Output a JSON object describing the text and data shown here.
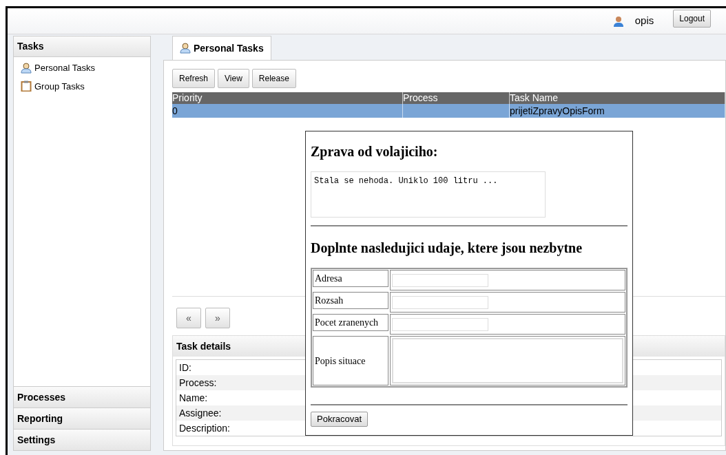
{
  "header": {
    "user": "opis",
    "logout": "Logout"
  },
  "sidebar": {
    "title": "Tasks",
    "items": [
      {
        "label": "Personal Tasks",
        "kind": "person"
      },
      {
        "label": "Group Tasks",
        "kind": "clipboard"
      }
    ],
    "sections": [
      "Processes",
      "Reporting",
      "Settings"
    ]
  },
  "tabs": [
    {
      "label": "Personal Tasks",
      "selected": true
    }
  ],
  "toolbar": [
    "Refresh",
    "View",
    "Release"
  ],
  "table": {
    "columns": [
      "Priority",
      "Process",
      "Task Name"
    ],
    "rows": [
      {
        "cells": [
          "0",
          "",
          "prijetiZpravyOpisForm"
        ],
        "selected": true
      }
    ]
  },
  "pager": [
    "«",
    "»"
  ],
  "details": {
    "title": "Task details",
    "fields": [
      "ID:",
      "Process:",
      "Name:",
      "Assignee:",
      "Description:"
    ]
  },
  "dialog": {
    "heading": "Zprava od volajiciho:",
    "message": "Stala se nehoda. Uniklo 100 litru ...",
    "heading_2": "Doplnte nasledujici udaje, ktere jsou nezbytne",
    "fields": [
      {
        "label": "Adresa",
        "kind": "input"
      },
      {
        "label": "Rozsah",
        "kind": "input"
      },
      {
        "label": "Pocet zranenych",
        "kind": "input"
      },
      {
        "label": "Popis situace",
        "kind": "textarea"
      }
    ],
    "button": "Pokracovat"
  }
}
